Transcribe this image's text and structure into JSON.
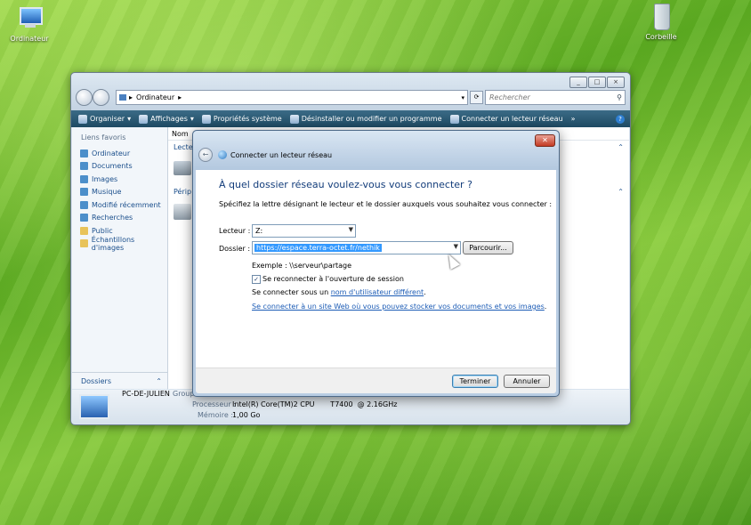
{
  "desktop": {
    "icons": [
      {
        "label": "Ordinateur",
        "icon": "computer-icon"
      },
      {
        "label": "Corbeille",
        "icon": "recycle-bin-icon"
      }
    ]
  },
  "explorer": {
    "address_path": "Ordinateur",
    "search_placeholder": "Rechercher",
    "toolbar": {
      "organize": "Organiser",
      "views": "Affichages",
      "system_props": "Propriétés système",
      "uninstall": "Désinstaller ou modifier un programme",
      "map_drive": "Connecter un lecteur réseau",
      "more": "»"
    },
    "sidebar": {
      "header": "Liens favoris",
      "items": [
        {
          "label": "Ordinateur"
        },
        {
          "label": "Documents"
        },
        {
          "label": "Images"
        },
        {
          "label": "Musique"
        },
        {
          "label": "Modifié récemment"
        },
        {
          "label": "Recherches"
        },
        {
          "label": "Public"
        },
        {
          "label": "Échantillons d'images"
        }
      ],
      "folders_label": "Dossiers"
    },
    "main": {
      "col_name": "Nom",
      "group_drives": "Lectet",
      "group_devices": "Périp"
    },
    "details": {
      "pc_name": "PC-DE-JULIEN",
      "group_label": "Group",
      "cpu_label": "Processeur :",
      "cpu_value": "Intel(R) Core(TM)2 CPU       T7400  @ 2.16GHz",
      "mem_label": "Mémoire :",
      "mem_value": "1,00 Go"
    }
  },
  "dialog": {
    "title": "Connecter un lecteur réseau",
    "heading": "À quel dossier réseau voulez-vous vous connecter ?",
    "description": "Spécifiez la lettre désignant le lecteur et le dossier auxquels vous souhaitez vous connecter :",
    "drive_label": "Lecteur :",
    "drive_value": "Z:",
    "folder_label": "Dossier :",
    "folder_value": "https://espace.terra-octet.fr/nethik",
    "browse_label": "Parcourir...",
    "example": "Exemple : \\\\serveur\\partage",
    "reconnect_label": "Se reconnecter à l'ouverture de session",
    "reconnect_checked": true,
    "other_user_prefix": "Se connecter sous un ",
    "other_user_link": "nom d'utilisateur différent",
    "other_user_suffix": ".",
    "website_link": "Se connecter à un site Web où vous pouvez stocker vos documents et vos images",
    "website_suffix": ".",
    "finish_label": "Terminer",
    "cancel_label": "Annuler"
  }
}
